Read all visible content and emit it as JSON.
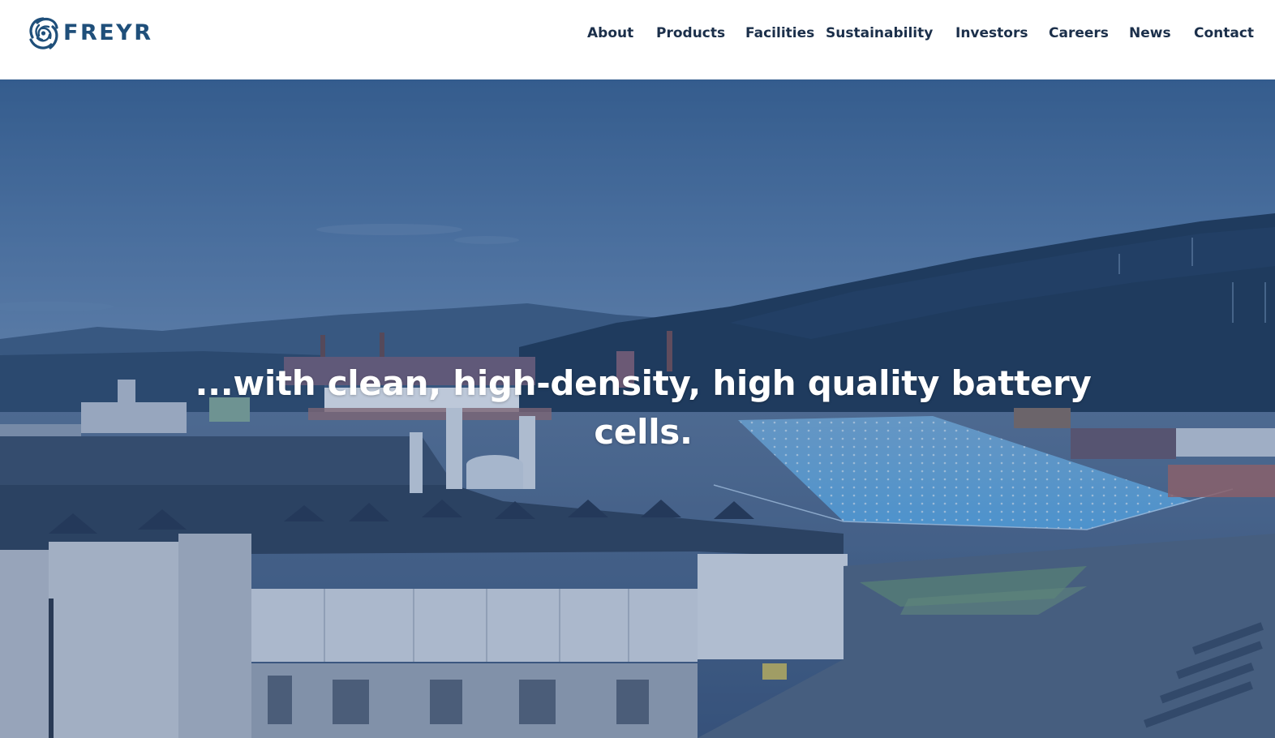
{
  "brand": {
    "name": "FREYR",
    "logo_icon": "swirl-logo-icon",
    "color": "#1f4f7a"
  },
  "nav": {
    "items": [
      {
        "label": "About"
      },
      {
        "label": "Products"
      },
      {
        "label": "Facilities"
      },
      {
        "label": "Sustainability"
      },
      {
        "label": "Investors"
      },
      {
        "label": "Careers"
      },
      {
        "label": "News"
      },
      {
        "label": "Contact"
      }
    ],
    "text_color": "#1b2f4a"
  },
  "hero": {
    "heading": "...with clean, high-density, high quality battery cells.",
    "overlay_color": "#26487f",
    "background": "aerial-industrial-site-image"
  }
}
